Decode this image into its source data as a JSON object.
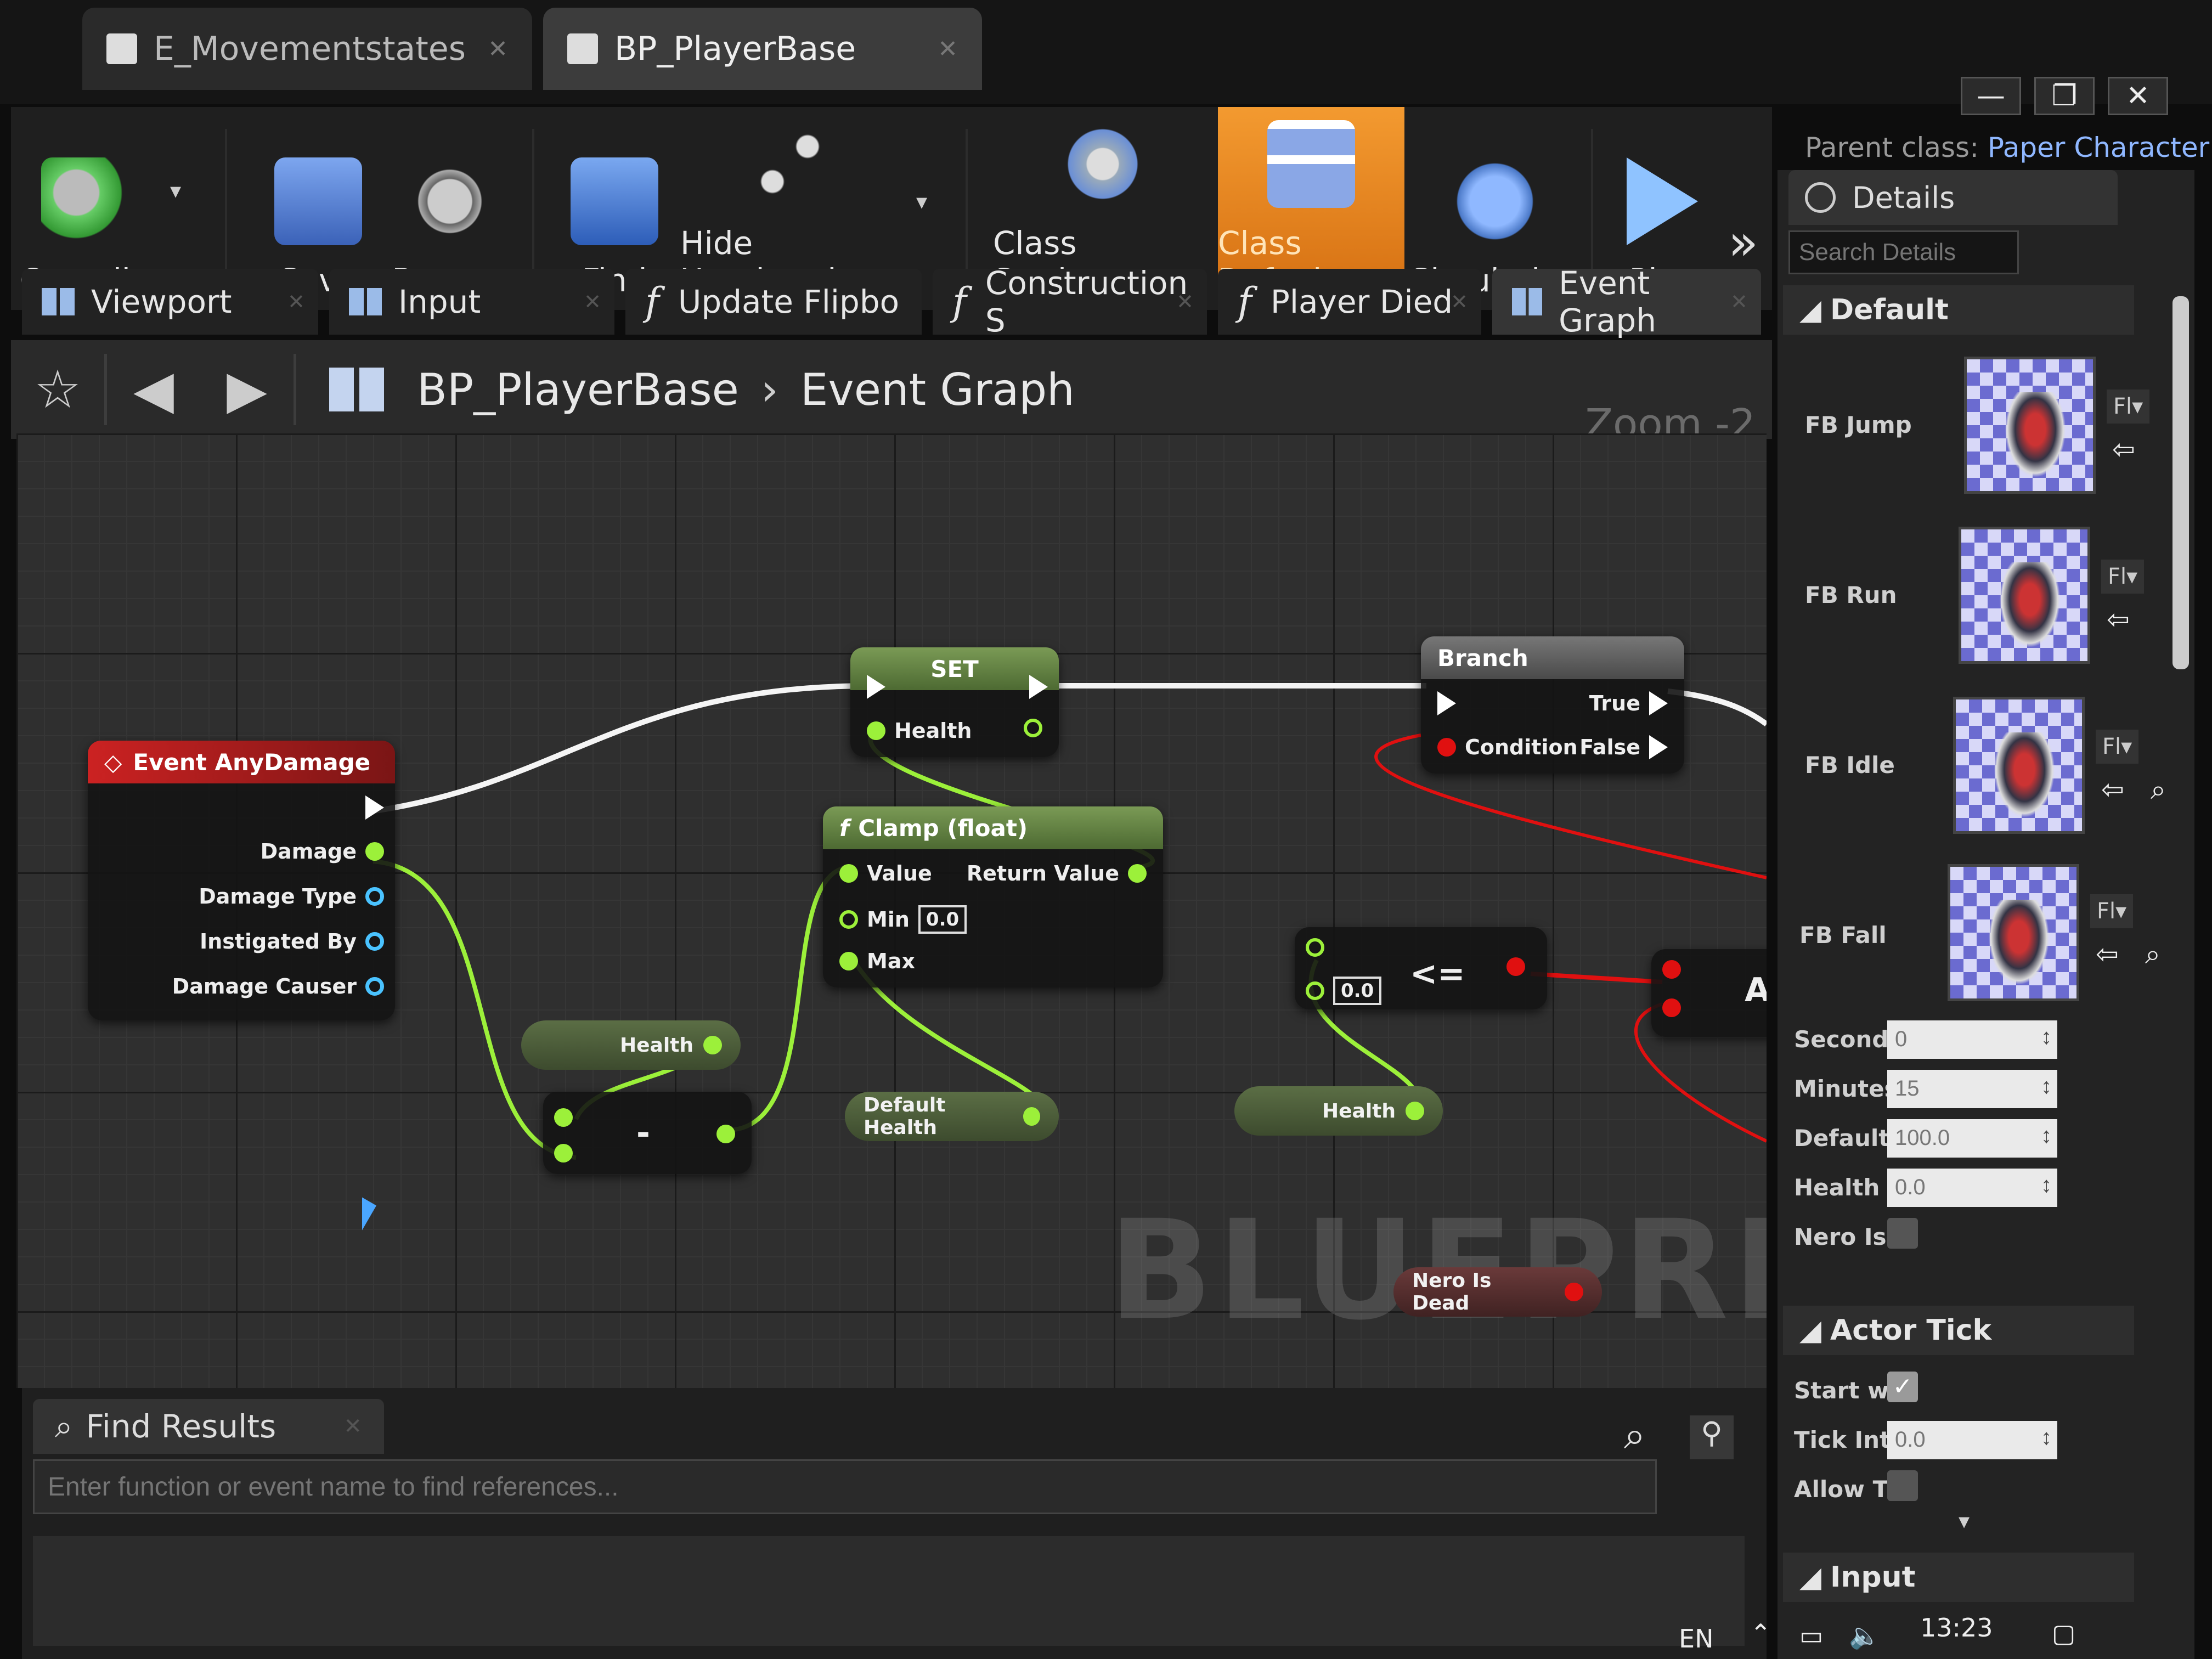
{
  "window": {
    "tabs": [
      {
        "label": "E_Movementstates"
      },
      {
        "label": "BP_PlayerBase"
      }
    ],
    "controls": {
      "minimize": "—",
      "restore": "❐",
      "close": "✕"
    },
    "parent_class_label": "Parent class:",
    "parent_class_value": "Paper Character"
  },
  "toolbar": {
    "compile": "Compile",
    "save": "Save",
    "browse": "Browse",
    "find": "Find",
    "hide_unrelated": "Hide Unrelated",
    "class_settings": "Class Settings",
    "class_defaults": "Class Defaults",
    "simulation": "Simulation",
    "play": "Play"
  },
  "editor_tabs": {
    "viewport": "Viewport",
    "input": "Input",
    "update_flipbook": "Update Flipbo",
    "construction": "Construction S",
    "player_died": "Player Died",
    "event_graph": "Event Graph"
  },
  "breadcrumb": {
    "blueprint": "BP_PlayerBase",
    "graph": "Event Graph",
    "zoom": "Zoom -2"
  },
  "graph": {
    "watermark": "BLUEPRINT",
    "event_node": {
      "title": "Event AnyDamage",
      "pins": [
        "Damage",
        "Damage Type",
        "Instigated By",
        "Damage Causer"
      ]
    },
    "set_node": {
      "title": "SET",
      "pin": "Health"
    },
    "branch_node": {
      "title": "Branch",
      "condition": "Condition",
      "true": "True",
      "false": "False"
    },
    "clamp_node": {
      "title": "Clamp (float)",
      "value": "Value",
      "min": "Min",
      "min_value": "0.0",
      "max": "Max",
      "return": "Return Value"
    },
    "compare_node": {
      "value": "0.0",
      "op": "<="
    },
    "subtract_node": {
      "op": "-"
    },
    "var_health_1": "Health",
    "var_default_health": "Default Health",
    "var_health_2": "Health",
    "var_nero_dead": "Nero Is Dead",
    "partial_letter": "A"
  },
  "find_results": {
    "tab": "Find Results",
    "placeholder": "Enter function or event name to find references..."
  },
  "details": {
    "tab": "Details",
    "search_placeholder": "Search Details",
    "section_default": "Default",
    "flipbooks": [
      {
        "label": "FB Jump",
        "button": "Fl▾"
      },
      {
        "label": "FB Run",
        "button": "Fl▾"
      },
      {
        "label": "FB Idle",
        "button": "Fl▾"
      },
      {
        "label": "FB Fall",
        "button": "Fl▾"
      }
    ],
    "fields": [
      {
        "label": "Seconds",
        "value": "0"
      },
      {
        "label": "Minutes",
        "value": "15"
      },
      {
        "label": "Default H",
        "value": "100.0"
      },
      {
        "label": "Health",
        "value": "0.0"
      }
    ],
    "nero_label": "Nero Is D",
    "section_actor_tick": "Actor Tick",
    "start_label": "Start wit",
    "tick_label": "Tick Inte",
    "tick_value": "0.0",
    "allow_label": "Allow Ti",
    "section_input": "Input"
  },
  "taskbar": {
    "lang": "EN",
    "time": "13:23"
  },
  "colors": {
    "accent": "#f39a30",
    "exec_white": "#ffffff",
    "float_green": "#9cf03a",
    "bool_red": "#e01010",
    "object_blue": "#4ac3ff"
  }
}
